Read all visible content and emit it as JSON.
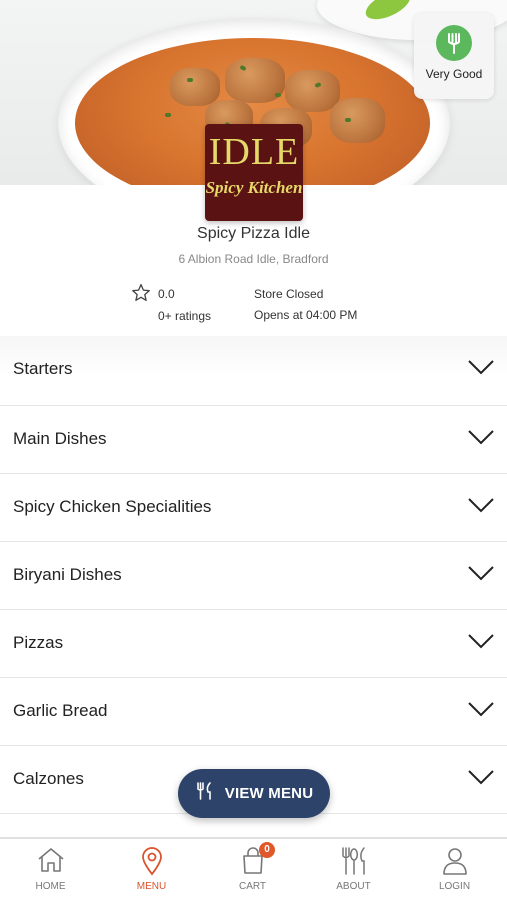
{
  "hero": {
    "rating_badge": {
      "label": "Very Good",
      "icon": "fork-icon",
      "color": "#5cb85c"
    }
  },
  "store": {
    "logo": {
      "line1": "IDLE",
      "line2": "Spicy Kitchen"
    },
    "name": "Spicy Pizza Idle",
    "address": "6 Albion Road Idle, Bradford",
    "rating": {
      "value": "0.0",
      "count": "0+ ratings"
    },
    "status": "Store Closed",
    "opens": "Opens at 04:00 PM"
  },
  "menu": {
    "categories": [
      {
        "label": "Starters"
      },
      {
        "label": "Main Dishes"
      },
      {
        "label": "Spicy Chicken Specialities"
      },
      {
        "label": "Biryani Dishes"
      },
      {
        "label": "Pizzas"
      },
      {
        "label": "Garlic Bread"
      },
      {
        "label": "Calzones"
      }
    ],
    "view_menu_label": "VIEW MENU"
  },
  "tabbar": {
    "home": "HOME",
    "menu": "MENU",
    "cart": "CART",
    "cart_count": "0",
    "about": "ABOUT",
    "login": "LOGIN",
    "active": "menu",
    "accent": "#d9532c"
  }
}
